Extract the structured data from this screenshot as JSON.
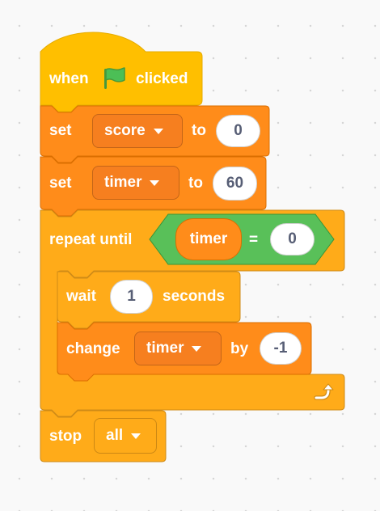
{
  "script": {
    "hat": {
      "when_label": "when",
      "flag_icon": "green-flag-icon",
      "clicked_label": "clicked"
    },
    "set_score": {
      "set_label": "set",
      "variable": "score",
      "to_label": "to",
      "value": "0"
    },
    "set_timer": {
      "set_label": "set",
      "variable": "timer",
      "to_label": "to",
      "value": "60"
    },
    "repeat_until": {
      "label": "repeat until",
      "condition": {
        "left_reporter": "timer",
        "operator": "=",
        "right_value": "0"
      },
      "loop_icon": "loop-arrow-icon"
    },
    "wait": {
      "wait_label": "wait",
      "value": "1",
      "seconds_label": "seconds"
    },
    "change_timer": {
      "change_label": "change",
      "variable": "timer",
      "by_label": "by",
      "value": "-1"
    },
    "stop": {
      "stop_label": "stop",
      "option": "all"
    }
  },
  "colors": {
    "events": "#ffbf00",
    "control": "#ffab19",
    "variables": "#ff8c1a",
    "operators": "#59c059",
    "workspace": "#f9f9f9"
  },
  "dropdown_icon": "dropdown-caret-icon"
}
